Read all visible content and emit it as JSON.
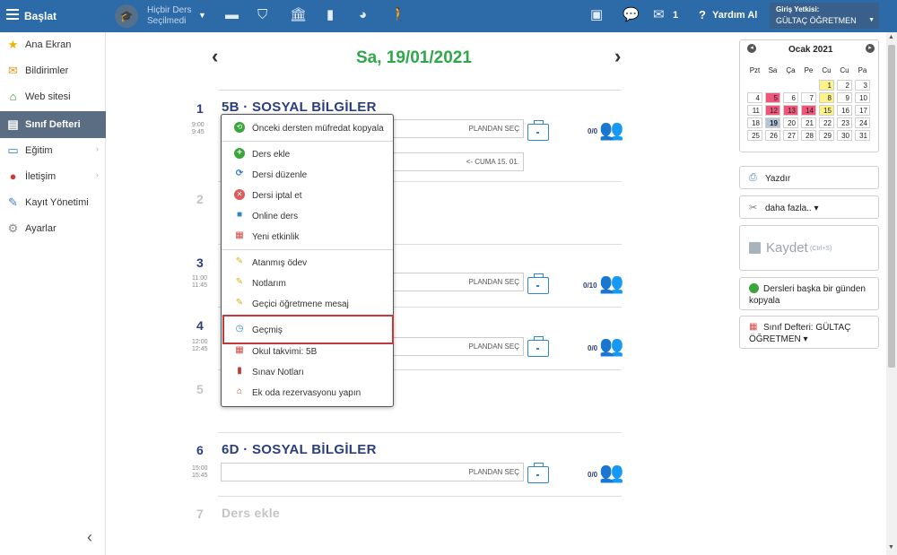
{
  "topbar": {
    "brand": "Başlat",
    "course_line1": "Hiçbir Ders",
    "course_line2": "Seçilmedi",
    "mail_count": "1",
    "help": "Yardım Al",
    "auth_label": "Giriş Yetkisi:",
    "auth_user": "GÜLTAÇ ÖĞRETMEN"
  },
  "sidebar": {
    "items": [
      {
        "label": "Ana Ekran",
        "icon": "star-icon"
      },
      {
        "label": "Bildirimler",
        "icon": "mail-icon"
      },
      {
        "label": "Web sitesi",
        "icon": "home-icon"
      },
      {
        "label": "Sınıf Defteri",
        "icon": "notebook-icon"
      },
      {
        "label": "Eğitim",
        "icon": "school-icon"
      },
      {
        "label": "İletişim",
        "icon": "chat-icon"
      },
      {
        "label": "Kayıt Yönetimi",
        "icon": "pen-icon"
      },
      {
        "label": "Ayarlar",
        "icon": "gear-icon"
      }
    ],
    "collapse": "‹"
  },
  "day": {
    "title": "Sa, 19/01/2021",
    "prev": "‹",
    "next": "›"
  },
  "lessons": [
    {
      "num": "1",
      "title": "5B · SOSYAL BİLGİLER",
      "time_start": "9:00",
      "time_end": "9:45",
      "plan": "PLANDAN SEÇ",
      "count": "0/0",
      "extra": "<- CUMA 15. 01."
    },
    {
      "num": "2"
    },
    {
      "num": "3",
      "time_start": "11:00",
      "time_end": "11:45",
      "plan": "PLANDAN SEÇ",
      "count": "0/10"
    },
    {
      "num": "4",
      "time_start": "12:00",
      "time_end": "12:45",
      "plan": "PLANDAN SEÇ",
      "count": "0/0"
    },
    {
      "num": "5"
    },
    {
      "num": "6",
      "title": "6D · SOSYAL BİLGİLER",
      "time_start": "15:00",
      "time_end": "15:45",
      "plan": "PLANDAN SEÇ",
      "count": "0/0"
    },
    {
      "num": "7",
      "title": "Ders ekle"
    }
  ],
  "menu": {
    "items": [
      {
        "label": "Önceki dersten müfredat kopyala",
        "icon": "copy-icon",
        "color": "#3aa53a"
      },
      {
        "label": "Ders ekle",
        "icon": "plus-circle-icon",
        "color": "#3aa53a"
      },
      {
        "label": "Dersi düzenle",
        "icon": "refresh-icon",
        "color": "#2f7cc8"
      },
      {
        "label": "Dersi iptal et",
        "icon": "cancel-icon",
        "color": "#e05a5a"
      },
      {
        "label": "Online ders",
        "icon": "video-icon",
        "color": "#2f86c6"
      },
      {
        "label": "Yeni etkinlik",
        "icon": "event-icon",
        "color": "#d04848"
      },
      {
        "label": "Atanmış ödev",
        "icon": "pencil-icon",
        "color": "#d7b21a"
      },
      {
        "label": "Notlarım",
        "icon": "pencil-icon",
        "color": "#d7b21a"
      },
      {
        "label": "Geçici öğretmene mesaj",
        "icon": "pencil-icon",
        "color": "#d7b21a"
      },
      {
        "label": "Geçmiş",
        "icon": "clock-icon",
        "color": "#2f86c6"
      },
      {
        "label": "Okul takvimi: 5B",
        "icon": "calendar-icon",
        "color": "#d04848"
      },
      {
        "label": "Sınav Notları",
        "icon": "book-icon",
        "color": "#c23a2a"
      },
      {
        "label": "Ek oda rezervasyonu yapın",
        "icon": "room-icon",
        "color": "#c23a2a"
      }
    ],
    "highlight_color": "#c0393b"
  },
  "calendar": {
    "month": "Ocak 2021",
    "weekdays": [
      "Pzt",
      "Sa",
      "Ça",
      "Pe",
      "Cu",
      "Cu",
      "Pa"
    ],
    "weeks": [
      [
        "",
        "",
        "",
        "",
        "1",
        "2",
        "3"
      ],
      [
        "4",
        "5",
        "6",
        "7",
        "8",
        "9",
        "10"
      ],
      [
        "11",
        "12",
        "13",
        "14",
        "15",
        "16",
        "17"
      ],
      [
        "18",
        "19",
        "20",
        "21",
        "22",
        "23",
        "24"
      ],
      [
        "25",
        "26",
        "27",
        "28",
        "29",
        "30",
        "31"
      ]
    ],
    "pink_days": [
      "5",
      "12",
      "13",
      "14"
    ],
    "yellow_days": [
      "1",
      "8",
      "15"
    ],
    "selected_day": "19"
  },
  "actions": {
    "print": "Yazdır",
    "more": "daha fazla.. ▾",
    "save": "Kaydet",
    "save_hint": "(Ctrl+S)",
    "copy_day_1": "Dersleri başka bir günden",
    "copy_day_2": "kopyala",
    "notebook_1": "Sınıf Defteri: GÜLTAÇ",
    "notebook_2": "ÖĞRETMEN ▾"
  },
  "colors": {
    "topbar": "#2d6aa8",
    "accent_green": "#2ea84a",
    "lesson_title": "#2c3e7a",
    "sidebar_active": "#5a6d82"
  }
}
